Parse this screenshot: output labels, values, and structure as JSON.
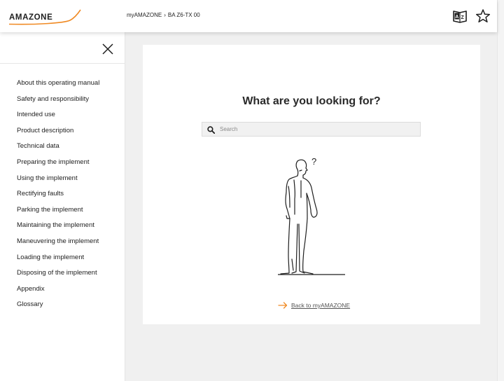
{
  "header": {
    "logo_text": "AMAZONE",
    "breadcrumb": [
      "myAMAZONE",
      "BA Z6-TX 00"
    ],
    "breadcrumb_separator": "›",
    "glossary_icon": "glossary-book-icon",
    "favorites_icon": "star-icon"
  },
  "sidebar": {
    "close_icon": "close-icon",
    "items": [
      {
        "label": "About this operating manual"
      },
      {
        "label": "Safety and responsibility"
      },
      {
        "label": "Intended use"
      },
      {
        "label": "Product description"
      },
      {
        "label": "Technical data"
      },
      {
        "label": "Preparing the implement"
      },
      {
        "label": "Using the implement"
      },
      {
        "label": "Rectifying faults"
      },
      {
        "label": "Parking the implement"
      },
      {
        "label": "Maintaining the implement"
      },
      {
        "label": "Maneuvering the implement"
      },
      {
        "label": "Loading the implement"
      },
      {
        "label": "Disposing of the implement"
      },
      {
        "label": "Appendix"
      },
      {
        "label": "Glossary"
      }
    ]
  },
  "main": {
    "title": "What are you looking for?",
    "search": {
      "placeholder": "Search",
      "value": ""
    },
    "question_mark": "?",
    "back_link": "Back to myAMAZONE"
  },
  "colors": {
    "brand_orange": "#f08a24",
    "text": "#1e1e1e",
    "background": "#f0f0f0"
  }
}
